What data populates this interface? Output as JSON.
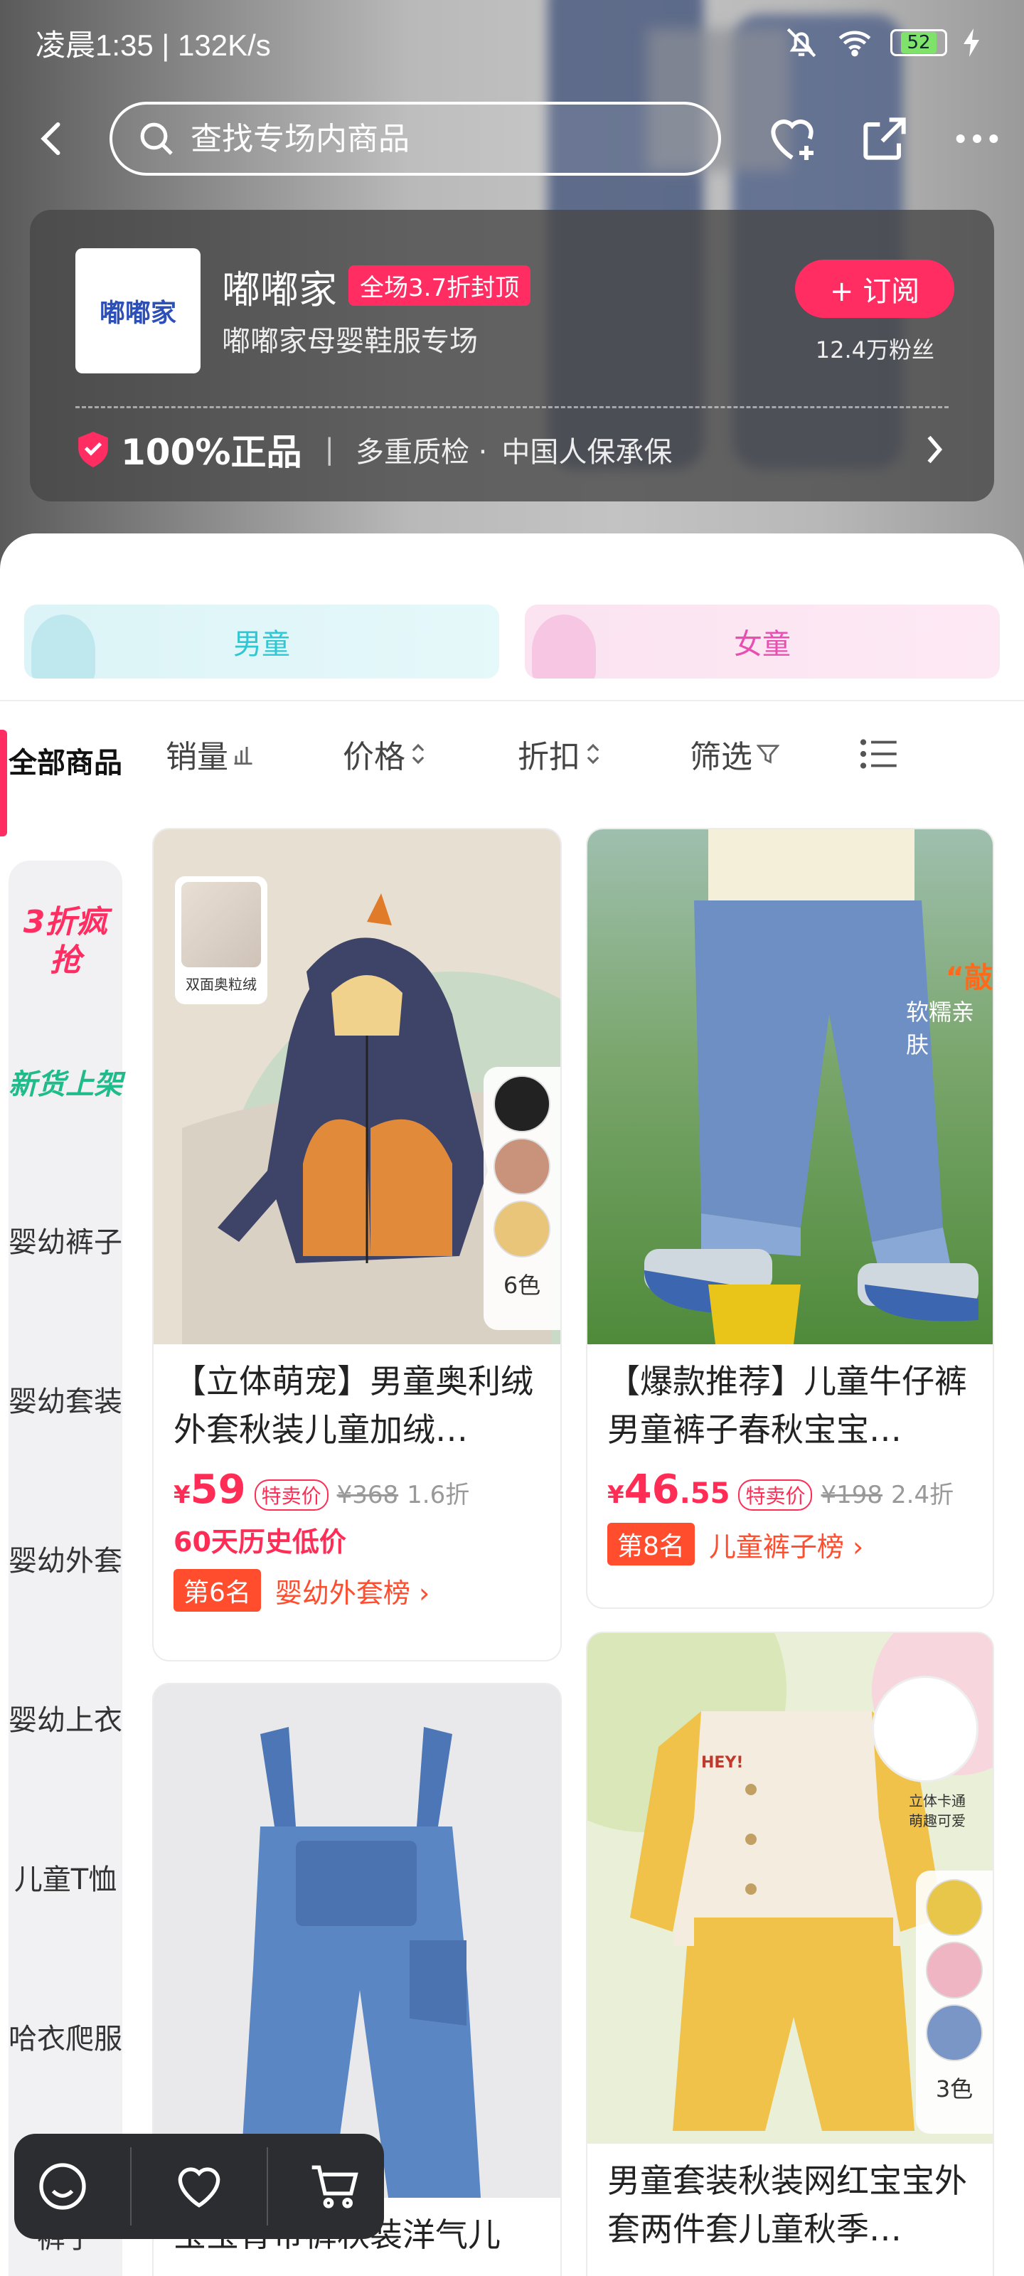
{
  "status_bar": {
    "time": "凌晨1:35 | 132K/s",
    "battery": "52"
  },
  "search": {
    "placeholder": "查找专场内商品"
  },
  "brand": {
    "logo_text": "嘟嘟家",
    "name": "嘟嘟家",
    "badge": "全场3.7折封顶",
    "subtitle": "嘟嘟家母婴鞋服专场",
    "subscribe_label": "+ 订阅",
    "fans": "12.4万粉丝",
    "guarantee_main": "100%正品",
    "guarantee_sep": "|",
    "guarantee_items": [
      "多重质检 ·",
      "中国人保承保"
    ]
  },
  "gender_tabs": [
    {
      "label": "男童"
    },
    {
      "label": "女童"
    }
  ],
  "sidebar": {
    "items": [
      {
        "label": "全部商品"
      },
      {
        "label": "3折疯抢"
      },
      {
        "label": "新货上架"
      },
      {
        "label": "婴幼裤子"
      },
      {
        "label": "婴幼套装"
      },
      {
        "label": "婴幼外套"
      },
      {
        "label": "婴幼上衣"
      },
      {
        "label": "儿童T恤"
      },
      {
        "label": "哈衣爬服"
      },
      {
        "label": "裤子"
      }
    ]
  },
  "sort_bar": {
    "items": [
      {
        "label": "销量"
      },
      {
        "label": "价格"
      },
      {
        "label": "折扣"
      },
      {
        "label": "筛选"
      }
    ]
  },
  "products": [
    {
      "title": "【立体萌宠】男童奥利绒外套秋装儿童加绒…",
      "img_tag": "双面奥粒绒",
      "price_currency": "¥",
      "price_int": "59",
      "price_dec": "",
      "price_tag": "特卖价",
      "orig_price": "¥368",
      "discount": "1.6折",
      "history": "60天历史低价",
      "rank": "第6名",
      "rank_list": "婴幼外套榜 ›",
      "colors_label": "6色"
    },
    {
      "title": "【爆款推荐】儿童牛仔裤男童裤子春秋宝宝…",
      "img_text_1": "“敲",
      "img_text_2": "软糯亲肤",
      "price_currency": "¥",
      "price_int": "46",
      "price_dec": ".55",
      "price_tag": "特卖价",
      "orig_price": "¥198",
      "discount": "2.4折",
      "rank": "第8名",
      "rank_list": "儿童裤子榜 ›"
    },
    {
      "title": "宝宝背带裤秋装洋气儿"
    },
    {
      "title": "男童套装秋装网红宝宝外套两件套儿童秋季…",
      "img_text": "立体卡通\n萌趣可爱",
      "jacket_text": "HEY!",
      "colors_label": "3色"
    }
  ],
  "colors": {
    "accent": "#ff2d62",
    "price": "#ff2d55",
    "rank": "#ff4d2e"
  }
}
